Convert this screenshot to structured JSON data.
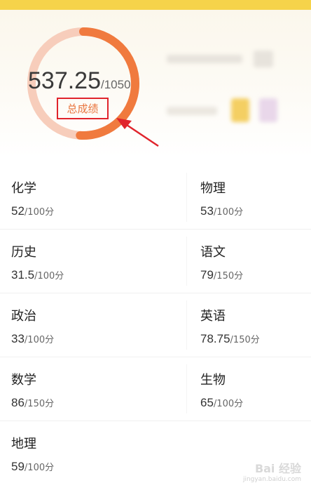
{
  "summary": {
    "total": "537.25",
    "max": "/1050",
    "label": "总成绩",
    "progress": 0.51
  },
  "subjects": [
    {
      "name": "化学",
      "score": "52",
      "max": "/100分"
    },
    {
      "name": "物理",
      "score": "53",
      "max": "/100分"
    },
    {
      "name": "历史",
      "score": "31.5",
      "max": "/100分"
    },
    {
      "name": "语文",
      "score": "79",
      "max": "/150分"
    },
    {
      "name": "政治",
      "score": "33",
      "max": "/100分"
    },
    {
      "name": "英语",
      "score": "78.75",
      "max": "/150分"
    },
    {
      "name": "数学",
      "score": "86",
      "max": "/150分"
    },
    {
      "name": "生物",
      "score": "65",
      "max": "/100分"
    },
    {
      "name": "地理",
      "score": "59",
      "max": "/100分"
    }
  ],
  "watermark": {
    "line1": "Bai 经验",
    "line2": "jingyan.baidu.com"
  },
  "colors": {
    "accent": "#f07a3e",
    "ring_track": "#f7cdbb",
    "highlight": "#e0242c",
    "top_bar": "#f6d34a"
  }
}
